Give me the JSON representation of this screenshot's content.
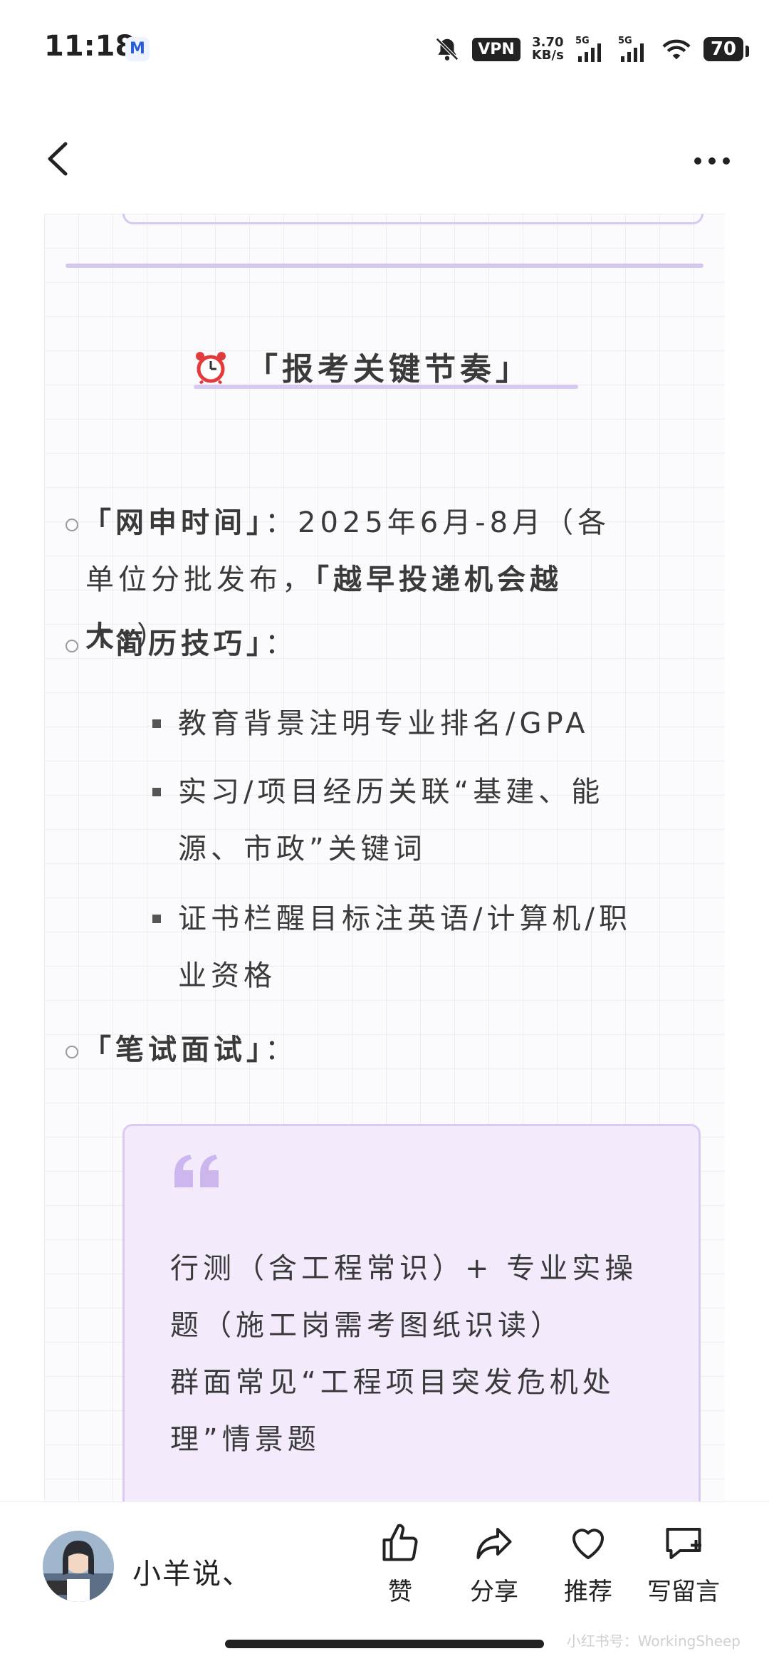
{
  "status_bar": {
    "time": "11:18",
    "app_badge": "M",
    "vpn": "VPN",
    "speed_value": "3.70",
    "speed_unit": "KB/s",
    "battery": "70"
  },
  "section": {
    "title": "「报考关键节奏」"
  },
  "items": {
    "apply_label": "「网申时间」",
    "apply_text1": "：2025年6月-8月（各",
    "apply_text2": "单位分批发布，",
    "apply_bold1": "「越早投递机会越",
    "apply_bold2": "大」",
    "apply_close": "）",
    "resume_label": "「简历技巧」",
    "resume_colon": "：",
    "resume_tip1": "教育背景注明专业排名/GPA",
    "resume_tip2_line1": "实习/项目经历关联“基建、能",
    "resume_tip2_line2": "源、市政”关键词",
    "resume_tip3_line1": "证书栏醒目标注英语/计算机/职",
    "resume_tip3_line2": "业资格",
    "exam_label": "「笔试面试」",
    "exam_colon": "："
  },
  "quote": {
    "line1": "行测（含工程常识）+ 专业实操",
    "line2": "题（施工岗需考图纸识读）",
    "line3": "群面常见“工程项目突发危机处",
    "line4": "理”情景题"
  },
  "bottom": {
    "author": "小羊说、",
    "like": "赞",
    "share": "分享",
    "recommend": "推荐",
    "comment": "写留言",
    "watermark": "小红书号：WorkingSheep"
  }
}
